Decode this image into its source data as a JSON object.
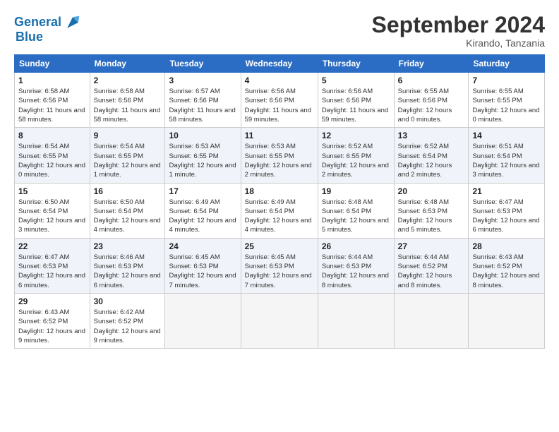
{
  "header": {
    "logo_line1": "General",
    "logo_line2": "Blue",
    "month": "September 2024",
    "location": "Kirando, Tanzania"
  },
  "weekdays": [
    "Sunday",
    "Monday",
    "Tuesday",
    "Wednesday",
    "Thursday",
    "Friday",
    "Saturday"
  ],
  "weeks": [
    [
      {
        "day": "1",
        "sunrise": "6:58 AM",
        "sunset": "6:56 PM",
        "daylight": "11 hours and 58 minutes."
      },
      {
        "day": "2",
        "sunrise": "6:58 AM",
        "sunset": "6:56 PM",
        "daylight": "11 hours and 58 minutes."
      },
      {
        "day": "3",
        "sunrise": "6:57 AM",
        "sunset": "6:56 PM",
        "daylight": "11 hours and 58 minutes."
      },
      {
        "day": "4",
        "sunrise": "6:56 AM",
        "sunset": "6:56 PM",
        "daylight": "11 hours and 59 minutes."
      },
      {
        "day": "5",
        "sunrise": "6:56 AM",
        "sunset": "6:56 PM",
        "daylight": "11 hours and 59 minutes."
      },
      {
        "day": "6",
        "sunrise": "6:55 AM",
        "sunset": "6:56 PM",
        "daylight": "12 hours and 0 minutes."
      },
      {
        "day": "7",
        "sunrise": "6:55 AM",
        "sunset": "6:55 PM",
        "daylight": "12 hours and 0 minutes."
      }
    ],
    [
      {
        "day": "8",
        "sunrise": "6:54 AM",
        "sunset": "6:55 PM",
        "daylight": "12 hours and 0 minutes."
      },
      {
        "day": "9",
        "sunrise": "6:54 AM",
        "sunset": "6:55 PM",
        "daylight": "12 hours and 1 minute."
      },
      {
        "day": "10",
        "sunrise": "6:53 AM",
        "sunset": "6:55 PM",
        "daylight": "12 hours and 1 minute."
      },
      {
        "day": "11",
        "sunrise": "6:53 AM",
        "sunset": "6:55 PM",
        "daylight": "12 hours and 2 minutes."
      },
      {
        "day": "12",
        "sunrise": "6:52 AM",
        "sunset": "6:55 PM",
        "daylight": "12 hours and 2 minutes."
      },
      {
        "day": "13",
        "sunrise": "6:52 AM",
        "sunset": "6:54 PM",
        "daylight": "12 hours and 2 minutes."
      },
      {
        "day": "14",
        "sunrise": "6:51 AM",
        "sunset": "6:54 PM",
        "daylight": "12 hours and 3 minutes."
      }
    ],
    [
      {
        "day": "15",
        "sunrise": "6:50 AM",
        "sunset": "6:54 PM",
        "daylight": "12 hours and 3 minutes."
      },
      {
        "day": "16",
        "sunrise": "6:50 AM",
        "sunset": "6:54 PM",
        "daylight": "12 hours and 4 minutes."
      },
      {
        "day": "17",
        "sunrise": "6:49 AM",
        "sunset": "6:54 PM",
        "daylight": "12 hours and 4 minutes."
      },
      {
        "day": "18",
        "sunrise": "6:49 AM",
        "sunset": "6:54 PM",
        "daylight": "12 hours and 4 minutes."
      },
      {
        "day": "19",
        "sunrise": "6:48 AM",
        "sunset": "6:54 PM",
        "daylight": "12 hours and 5 minutes."
      },
      {
        "day": "20",
        "sunrise": "6:48 AM",
        "sunset": "6:53 PM",
        "daylight": "12 hours and 5 minutes."
      },
      {
        "day": "21",
        "sunrise": "6:47 AM",
        "sunset": "6:53 PM",
        "daylight": "12 hours and 6 minutes."
      }
    ],
    [
      {
        "day": "22",
        "sunrise": "6:47 AM",
        "sunset": "6:53 PM",
        "daylight": "12 hours and 6 minutes."
      },
      {
        "day": "23",
        "sunrise": "6:46 AM",
        "sunset": "6:53 PM",
        "daylight": "12 hours and 6 minutes."
      },
      {
        "day": "24",
        "sunrise": "6:45 AM",
        "sunset": "6:53 PM",
        "daylight": "12 hours and 7 minutes."
      },
      {
        "day": "25",
        "sunrise": "6:45 AM",
        "sunset": "6:53 PM",
        "daylight": "12 hours and 7 minutes."
      },
      {
        "day": "26",
        "sunrise": "6:44 AM",
        "sunset": "6:53 PM",
        "daylight": "12 hours and 8 minutes."
      },
      {
        "day": "27",
        "sunrise": "6:44 AM",
        "sunset": "6:52 PM",
        "daylight": "12 hours and 8 minutes."
      },
      {
        "day": "28",
        "sunrise": "6:43 AM",
        "sunset": "6:52 PM",
        "daylight": "12 hours and 8 minutes."
      }
    ],
    [
      {
        "day": "29",
        "sunrise": "6:43 AM",
        "sunset": "6:52 PM",
        "daylight": "12 hours and 9 minutes."
      },
      {
        "day": "30",
        "sunrise": "6:42 AM",
        "sunset": "6:52 PM",
        "daylight": "12 hours and 9 minutes."
      },
      null,
      null,
      null,
      null,
      null
    ]
  ]
}
